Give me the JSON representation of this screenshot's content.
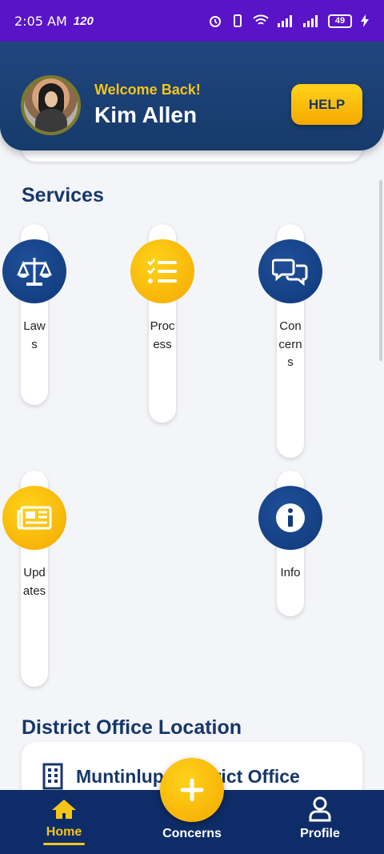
{
  "status_bar": {
    "time": "2:05 AM",
    "refresh": "120",
    "battery": "49"
  },
  "header": {
    "welcome": "Welcome Back!",
    "user_name": "Kim Allen",
    "help_label": "HELP"
  },
  "services": {
    "title": "Services",
    "items": [
      {
        "label": "Laws",
        "icon": "scale-icon"
      },
      {
        "label": "Process",
        "icon": "checklist-icon"
      },
      {
        "label": "Concerns",
        "icon": "chat-bubbles-icon"
      },
      {
        "label": "Updates",
        "icon": "newspaper-icon"
      },
      {
        "label": "Info",
        "icon": "info-icon"
      }
    ]
  },
  "location": {
    "title": "District Office Location",
    "office_name": "Muntinlupa District Office"
  },
  "bottom_nav": {
    "home": "Home",
    "concerns": "Concerns",
    "profile": "Profile",
    "fab_icon": "plus-icon"
  },
  "colors": {
    "primary": "#15376a",
    "accent": "#f5c518",
    "status_bar": "#5a14c8"
  }
}
